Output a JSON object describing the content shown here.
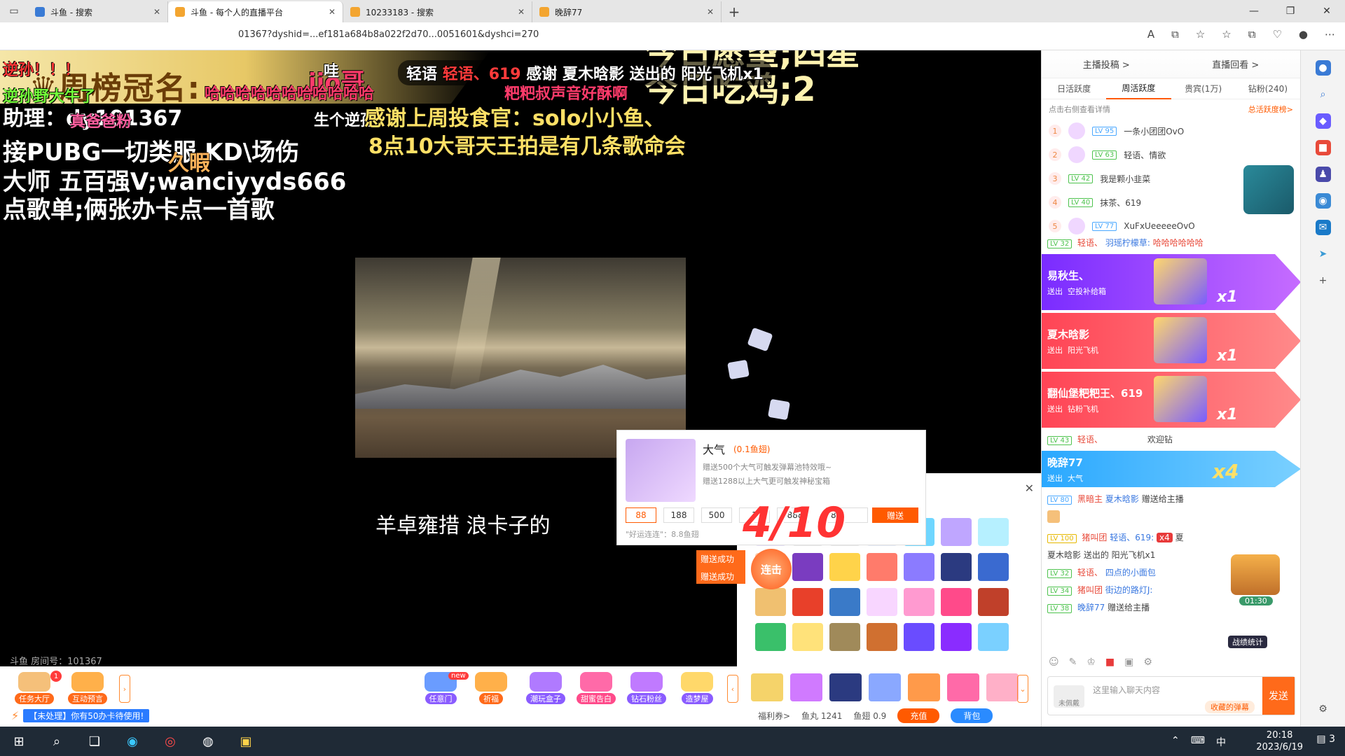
{
  "browser": {
    "tabs": [
      {
        "label": "斗鱼 - 搜索"
      },
      {
        "label": "斗鱼 - 每个人的直播平台"
      },
      {
        "label": "10233183 - 搜索"
      },
      {
        "label": "晚辞77"
      }
    ],
    "new_tab": "+",
    "window_controls": [
      "—",
      "❐",
      "✕"
    ],
    "url": "01367?dyshid=...ef181a684b8a022f2d70...0051601&dyshci=270",
    "addr_icons": [
      "A",
      "⧉",
      "☆",
      "☆",
      "⧉",
      "♡",
      "●",
      "⋯"
    ]
  },
  "overlay": {
    "crown_title": "周榜冠名:",
    "crown_name": "jio哥",
    "wish_line1": "今日愿望;四星",
    "wish_line2": "今日吃鸡;2",
    "wa": "哇",
    "lines": [
      "逆孙！！！",
      "逆孙野大牛了",
      "助理：dy101367",
      "真爸爸粉",
      "哈哈哈哈哈哈哈哈哈哈哈",
      "粑粑叔声音好酥啊",
      "生个逆孙",
      "感谢上周投食官：solo小小鱼、",
      "8点10大哥天王拍是有几条歌命会",
      "接PUBG一切类服 KD\\场伤",
      "大师 五百强V;wanciyyds666",
      "点歌单;俩张办卡点一首歌",
      "久暇"
    ],
    "thanks_bar": {
      "prefix": "轻语",
      "name": "轻语、619",
      "text": "感谢 夏木晗影 送出的 阳光飞机x1"
    },
    "subtitle": "羊卓雍措 浪卡子的",
    "room_no": "斗鱼 房间号：101367"
  },
  "gift_popup": {
    "name": "大气",
    "price": "(0.1鱼翅)",
    "desc1": "赠送500个大气可触发弹幕池特效哦~",
    "desc2": "赠送1288以上大气更可触发神秘宝箱",
    "amounts": [
      "88",
      "188",
      "500",
      "1",
      "8888"
    ],
    "quantity": "88",
    "send": "赠送",
    "lucky": "\"好运连连\"：8.8鱼翅",
    "combo": "4/10",
    "success1": "赠送成功",
    "success2": "赠送成功",
    "lianji": "连击",
    "close": "✕"
  },
  "bottom": {
    "buttons": [
      {
        "label": "任务大厅"
      },
      {
        "label": "互动预言"
      },
      {
        "label": "任意门"
      },
      {
        "label": "祈福"
      },
      {
        "label": "潮玩盒子"
      },
      {
        "label": "甜蜜告白"
      },
      {
        "label": "钻石粉丝"
      },
      {
        "label": "造梦屋"
      }
    ],
    "task_badge": "1",
    "new_badge": "new",
    "notice": "【未处理】你有50办卡待使用!",
    "welfare": "福利券>",
    "fish_ball": "鱼丸 1241",
    "fish_fin": "鱼翅 0.9",
    "recharge": "充值",
    "backpack": "背包"
  },
  "right_panel": {
    "top_links": [
      "主播投稿 >",
      "直播回看 >"
    ],
    "tabs": [
      "日活跃度",
      "周活跃度",
      "贵宾(1万)",
      "钻粉(240)"
    ],
    "active_tab": 1,
    "hint": "点击右侧查看详情",
    "hint_more": "总活跃度榜>",
    "ranking": [
      {
        "rank": "1",
        "level": "LV 95",
        "name": "一条小团团OvO"
      },
      {
        "rank": "2",
        "level": "LV 63",
        "name": "轻语、情欲"
      },
      {
        "rank": "3",
        "level": "LV 42",
        "name": "我是颗小韭菜"
      },
      {
        "rank": "4",
        "level": "LV 40",
        "name": "抹茶、619"
      },
      {
        "rank": "5",
        "level": "LV 77",
        "name": "XuFxUeeeeeOvO"
      }
    ],
    "chat_top": {
      "level": "LV 32",
      "text": "轻语、",
      "name": "羽瑶柠檬草:",
      "msg": "哈哈哈哈哈哈"
    },
    "banners": [
      {
        "name": "易秋生、",
        "sent": "送出",
        "gift": "空投补给箱",
        "count": "x1"
      },
      {
        "name": "夏木晗影",
        "sent": "送出",
        "gift": "阳光飞机",
        "count": "x1"
      },
      {
        "name": "翻仙堡粑粑王、619",
        "sent": "送出",
        "gift": "钻粉飞机",
        "count": "x1"
      },
      {
        "name": "晚辞77",
        "sent": "送出",
        "gift": "大气",
        "count": "x4"
      }
    ],
    "chat": [
      {
        "level": "LV 43",
        "text": "轻语、",
        "msg": "欢迎钻"
      },
      {
        "level": "LV 80",
        "text": "黑暗主",
        "name": "夏木晗影",
        "msg": "赠送给主播"
      },
      {
        "level": "LV 100",
        "text": "猪叫团",
        "name": "轻语、619:",
        "msg": "夏木晗影 送出的 阳光飞机x1"
      },
      {
        "level": "LV 32",
        "text": "轻语、",
        "name": "四点的小面包",
        "msg": ""
      },
      {
        "level": "LV 34",
        "text": "猪叫团",
        "name": "街边的路灯J:",
        "msg": ""
      },
      {
        "level": "LV 38",
        "text": "",
        "name": "晚辞77",
        "msg": "赠送给主播"
      }
    ],
    "chest_timer": "01:30",
    "battle_stats": "战绩统计",
    "input_placeholder": "这里输入聊天内容",
    "collect_danmu": "收藏的弹幕",
    "no_face": "未佩戴",
    "send": "发送",
    "x4_badge": "x4",
    "x4_after": "夏"
  },
  "taskbar": {
    "time": "20:18",
    "date": "2023/6/19",
    "ime": "中",
    "notif_count": "3"
  }
}
